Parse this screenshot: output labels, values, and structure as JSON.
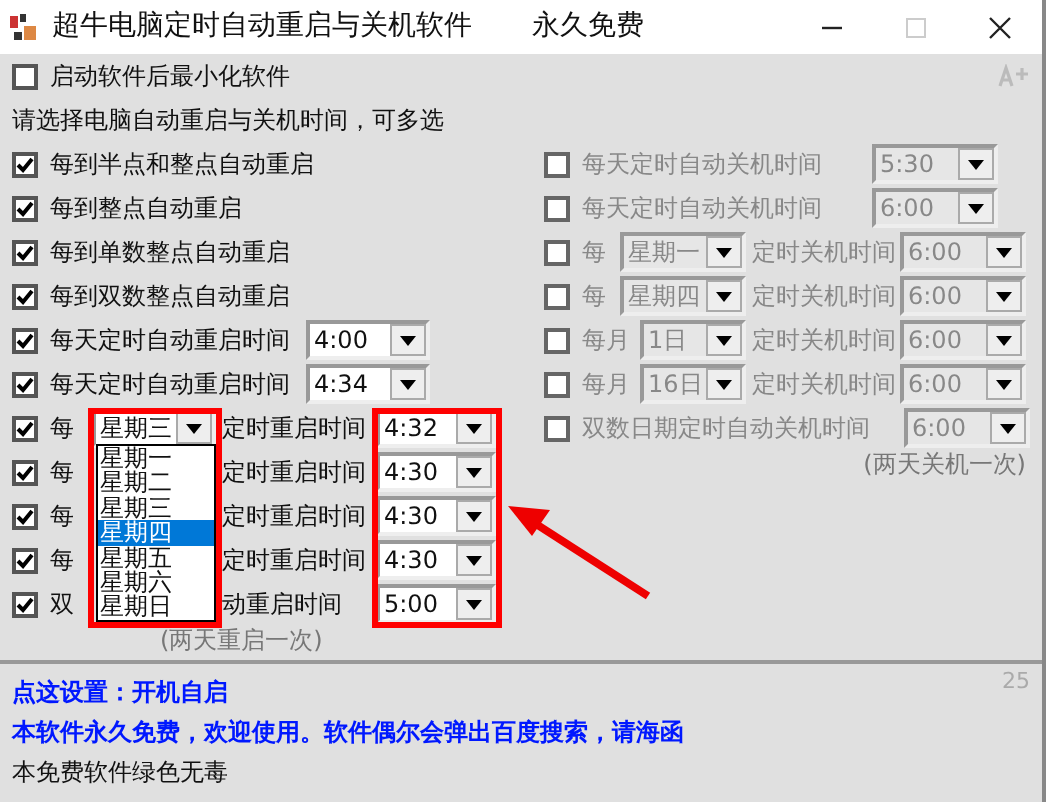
{
  "window": {
    "title": "超牛电脑定时自动重启与关机软件",
    "subtitle": "永久免费",
    "controls": [
      {
        "kind": "minimize",
        "disabled": false
      },
      {
        "kind": "maximize",
        "disabled": true
      },
      {
        "kind": "close",
        "disabled": false
      }
    ]
  },
  "minimize_option": {
    "label": "启动软件后最小化软件",
    "checked": false
  },
  "prompt": "请选择电脑自动重启与关机时间，可多选",
  "restart_options": [
    {
      "kind": "check",
      "label": "每到半点和整点自动重启",
      "checked": true
    },
    {
      "kind": "check",
      "label": "每到整点自动重启",
      "checked": true
    },
    {
      "kind": "check",
      "label": "每到单数整点自动重启",
      "checked": true
    },
    {
      "kind": "check",
      "label": "每到双数整点自动重启",
      "checked": true
    },
    {
      "kind": "daily",
      "label": "每天定时自动重启时间",
      "time": "4:00",
      "checked": true
    },
    {
      "kind": "daily",
      "label": "每天定时自动重启时间",
      "time": "4:34",
      "checked": true
    },
    {
      "kind": "weekly",
      "prefix": "每",
      "day": "星期三",
      "label": "定时重启时间",
      "time": "4:32",
      "checked": true
    },
    {
      "kind": "weekly",
      "prefix": "每",
      "label": "定时重启时间",
      "time": "4:30",
      "checked": true
    },
    {
      "kind": "monthly",
      "prefix": "每",
      "label": "定时重启时间",
      "time": "4:30",
      "checked": true
    },
    {
      "kind": "monthly",
      "prefix": "每",
      "label": "定时重启时间",
      "time": "4:30",
      "checked": true
    },
    {
      "kind": "even",
      "prefix": "双",
      "label": "动重启时间",
      "time": "5:00",
      "checked": true,
      "note": "(两天重启一次)"
    }
  ],
  "shutdown_options": [
    {
      "kind": "daily",
      "label": "每天定时自动关机时间",
      "time": "5:30",
      "checked": false,
      "disabled": true
    },
    {
      "kind": "daily",
      "label": "每天定时自动关机时间",
      "time": "6:00",
      "checked": false,
      "disabled": true
    },
    {
      "kind": "weekly",
      "prefix": "每",
      "day": "星期一",
      "label": "定时关机时间",
      "time": "6:00",
      "checked": false,
      "disabled": true
    },
    {
      "kind": "weekly",
      "prefix": "每",
      "day": "星期四",
      "label": "定时关机时间",
      "time": "6:00",
      "checked": false,
      "disabled": true
    },
    {
      "kind": "monthly",
      "prefix": "每月",
      "day": "1日",
      "label": "定时关机时间",
      "time": "6:00",
      "checked": false,
      "disabled": true
    },
    {
      "kind": "monthly",
      "prefix": "每月",
      "day": "16日",
      "label": "定时关机时间",
      "time": "6:00",
      "checked": false,
      "disabled": true
    },
    {
      "kind": "even",
      "label": "双数日期定时自动关机时间",
      "time": "6:00",
      "checked": false,
      "disabled": true,
      "note": "(两天关机一次)"
    }
  ],
  "weekday_list": [
    {
      "label": "星期一",
      "selected": false
    },
    {
      "label": "星期二",
      "selected": false
    },
    {
      "label": "星期三",
      "selected": false
    },
    {
      "label": "星期四",
      "selected": true
    },
    {
      "label": "星期五",
      "selected": false
    },
    {
      "label": "星期六",
      "selected": false
    },
    {
      "label": "星期日",
      "selected": false
    }
  ],
  "footer": {
    "counter": "25",
    "lines": [
      {
        "kind": "link",
        "text": "点这设置：开机自启"
      },
      {
        "kind": "notice",
        "text": "本软件永久免费，欢迎使用。软件偶尔会弹出百度搜索，请海函"
      },
      {
        "kind": "plain",
        "text": "本免费软件绿色无毒"
      }
    ]
  }
}
